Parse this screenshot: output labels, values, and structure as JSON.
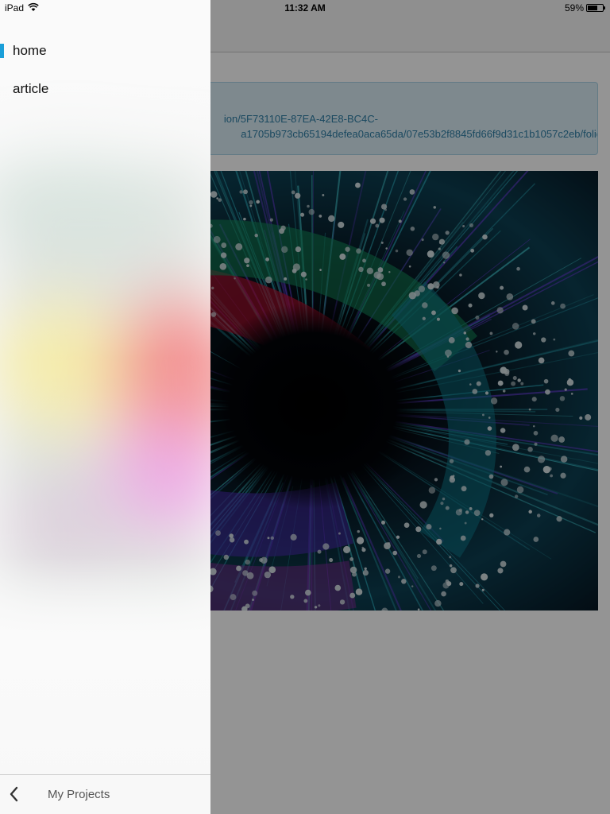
{
  "status_bar": {
    "device": "iPad",
    "time": "11:32 AM",
    "battery_percent_text": "59%",
    "battery_level": 0.59
  },
  "content": {
    "url_line1": "ion/5F73110E-87EA-42E8-BC4C-",
    "url_line2": "a1705b973cb65194defea0aca65da/07e53b2f8845fd66f9d31c1b1057c2eb/folio"
  },
  "drawer": {
    "items": [
      {
        "label": "home",
        "active": true
      },
      {
        "label": "article",
        "active": false
      }
    ],
    "footer_label": "My Projects",
    "back_icon": "chevron-left-icon"
  },
  "colors": {
    "accent": "#1a9fd9",
    "url_text": "#2f7fa6",
    "url_bg": "#d9ecf5"
  }
}
